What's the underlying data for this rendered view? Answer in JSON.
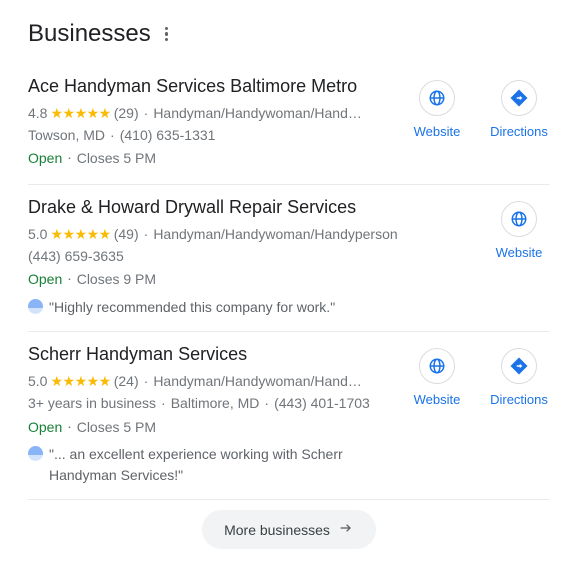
{
  "header": {
    "title": "Businesses"
  },
  "icons": {
    "website": "globe-icon",
    "directions": "directions-icon",
    "more": "arrow-right-icon"
  },
  "labels": {
    "website": "Website",
    "directions": "Directions",
    "more": "More businesses"
  },
  "listings": [
    {
      "name": "Ace Handyman Services Baltimore Metro",
      "rating": "4.8",
      "count": "(29)",
      "category": "Handyman/Handywoman/Hand…",
      "location": "Towson, MD",
      "phone": "(410) 635-1331",
      "status": "Open",
      "closes": "Closes 5 PM",
      "years": "",
      "review": "",
      "show_directions": true,
      "cat_ellipsis": true
    },
    {
      "name": "Drake & Howard Drywall Repair Services",
      "rating": "5.0",
      "count": "(49)",
      "category": "Handyman/Handywoman/Handyperson",
      "location": "",
      "phone": "(443) 659-3635",
      "status": "Open",
      "closes": "Closes 9 PM",
      "years": "",
      "review": "\"Highly recommended this company for work.\"",
      "show_directions": false,
      "cat_ellipsis": false
    },
    {
      "name": "Scherr Handyman Services",
      "rating": "5.0",
      "count": "(24)",
      "category": "Handyman/Handywoman/Hand…",
      "location": "Baltimore, MD",
      "phone": "(443) 401-1703",
      "status": "Open",
      "closes": "Closes 5 PM",
      "years": "3+ years in business",
      "review": "\"... an excellent experience working with Scherr Handyman Services!\"",
      "show_directions": true,
      "cat_ellipsis": true
    }
  ]
}
